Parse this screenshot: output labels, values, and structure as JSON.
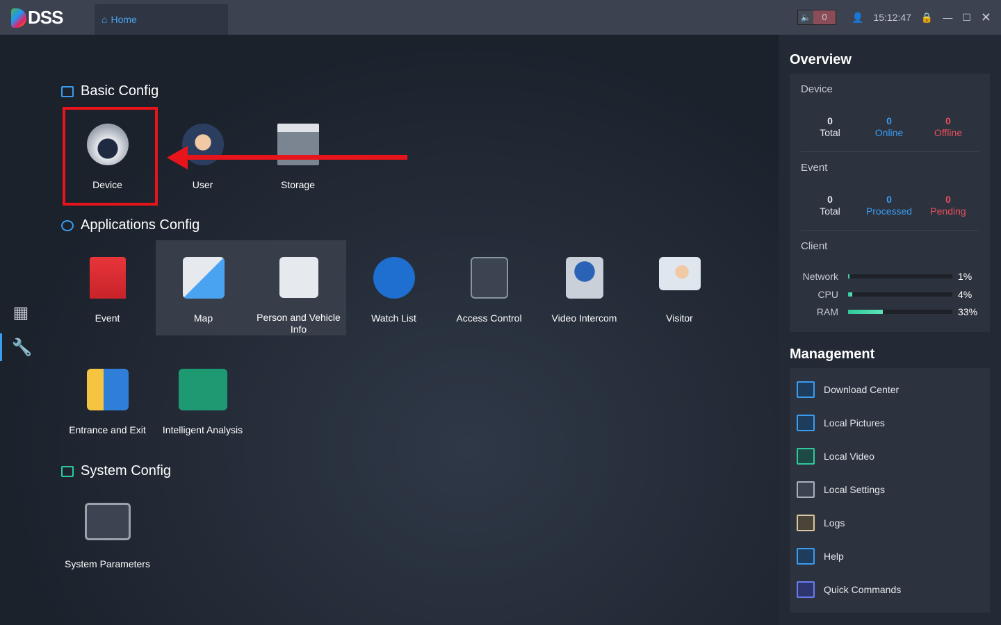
{
  "app": {
    "logo": "DSS",
    "tab": "Home",
    "alarm_count": "0",
    "time": "15:12:47"
  },
  "sections": {
    "basic": "Basic Config",
    "apps": "Applications Config",
    "system": "System Config"
  },
  "basic": [
    {
      "label": "Device"
    },
    {
      "label": "User"
    },
    {
      "label": "Storage"
    }
  ],
  "apps": [
    {
      "label": "Event"
    },
    {
      "label": "Map"
    },
    {
      "label": "Person and Vehicle Info"
    },
    {
      "label": "Watch List"
    },
    {
      "label": "Access Control"
    },
    {
      "label": "Video Intercom"
    },
    {
      "label": "Visitor"
    },
    {
      "label": "Entrance and Exit"
    },
    {
      "label": "Intelligent Analysis"
    }
  ],
  "system": [
    {
      "label": "System Parameters"
    }
  ],
  "overview": {
    "title": "Overview",
    "device": {
      "title": "Device",
      "total": "0",
      "total_label": "Total",
      "online": "0",
      "online_label": "Online",
      "offline": "0",
      "offline_label": "Offline"
    },
    "event": {
      "title": "Event",
      "total": "0",
      "total_label": "Total",
      "processed": "0",
      "processed_label": "Processed",
      "pending": "0",
      "pending_label": "Pending"
    },
    "client": {
      "title": "Client",
      "network_label": "Network",
      "network": "1%",
      "network_value": 1,
      "cpu_label": "CPU",
      "cpu": "4%",
      "cpu_value": 4,
      "ram_label": "RAM",
      "ram": "33%",
      "ram_value": 33
    }
  },
  "management": {
    "title": "Management",
    "items": [
      "Download Center",
      "Local Pictures",
      "Local Video",
      "Local Settings",
      "Logs",
      "Help",
      "Quick Commands"
    ]
  },
  "colors": {
    "accent": "#3a9cf0",
    "online": "#3a9cf0",
    "offline": "#e8505b",
    "highlight": "#e8141b",
    "bar": "#2fc99a"
  }
}
